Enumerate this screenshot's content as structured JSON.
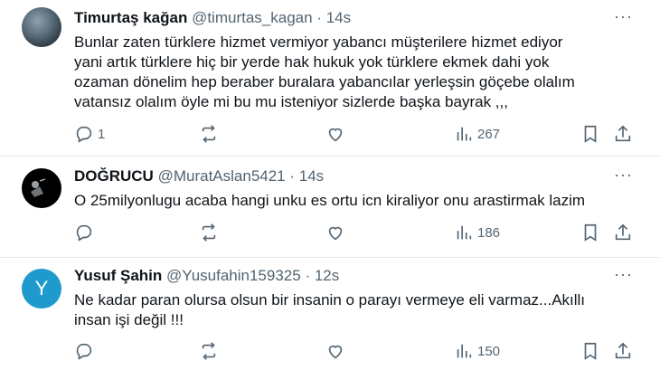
{
  "tweets": [
    {
      "name": "Timurtaş kağan",
      "handle": "@timurtas_kagan",
      "time": "14s",
      "text": "Bunlar zaten türklere hizmet vermiyor yabancı müşterilere hizmet ediyor\nyani artık türklere hiç bir yerde hak hukuk yok türklere ekmek dahi yok\nozaman dönelim hep beraber buralara yabancılar yerleşsin göçebe olalım\nvatansız olalım öyle mi bu mu isteniyor sizlerde başka bayrak ,,,",
      "replies": "1",
      "views": "267"
    },
    {
      "name": "DOĞRUCU",
      "handle": "@MuratAslan5421",
      "time": "14s",
      "text": "O 25milyonlugu acaba hangi unku es ortu icn kiraliyor onu arastirmak lazim",
      "replies": "",
      "views": "186"
    },
    {
      "name": "Yusuf Şahin",
      "handle": "@Yusufahin159325",
      "time": "12s",
      "avatar_letter": "Y",
      "text": "Ne kadar paran olursa olsun bir insanin o parayı vermeye eli varmaz...Akıllı\ninsan işi değil !!!",
      "replies": "",
      "views": "150"
    }
  ],
  "separator": " · ",
  "more_label": "···",
  "colors": {
    "secondary_text": "#536471",
    "divider": "#e6e9eb",
    "avatar_y": "#1e9bcc"
  }
}
